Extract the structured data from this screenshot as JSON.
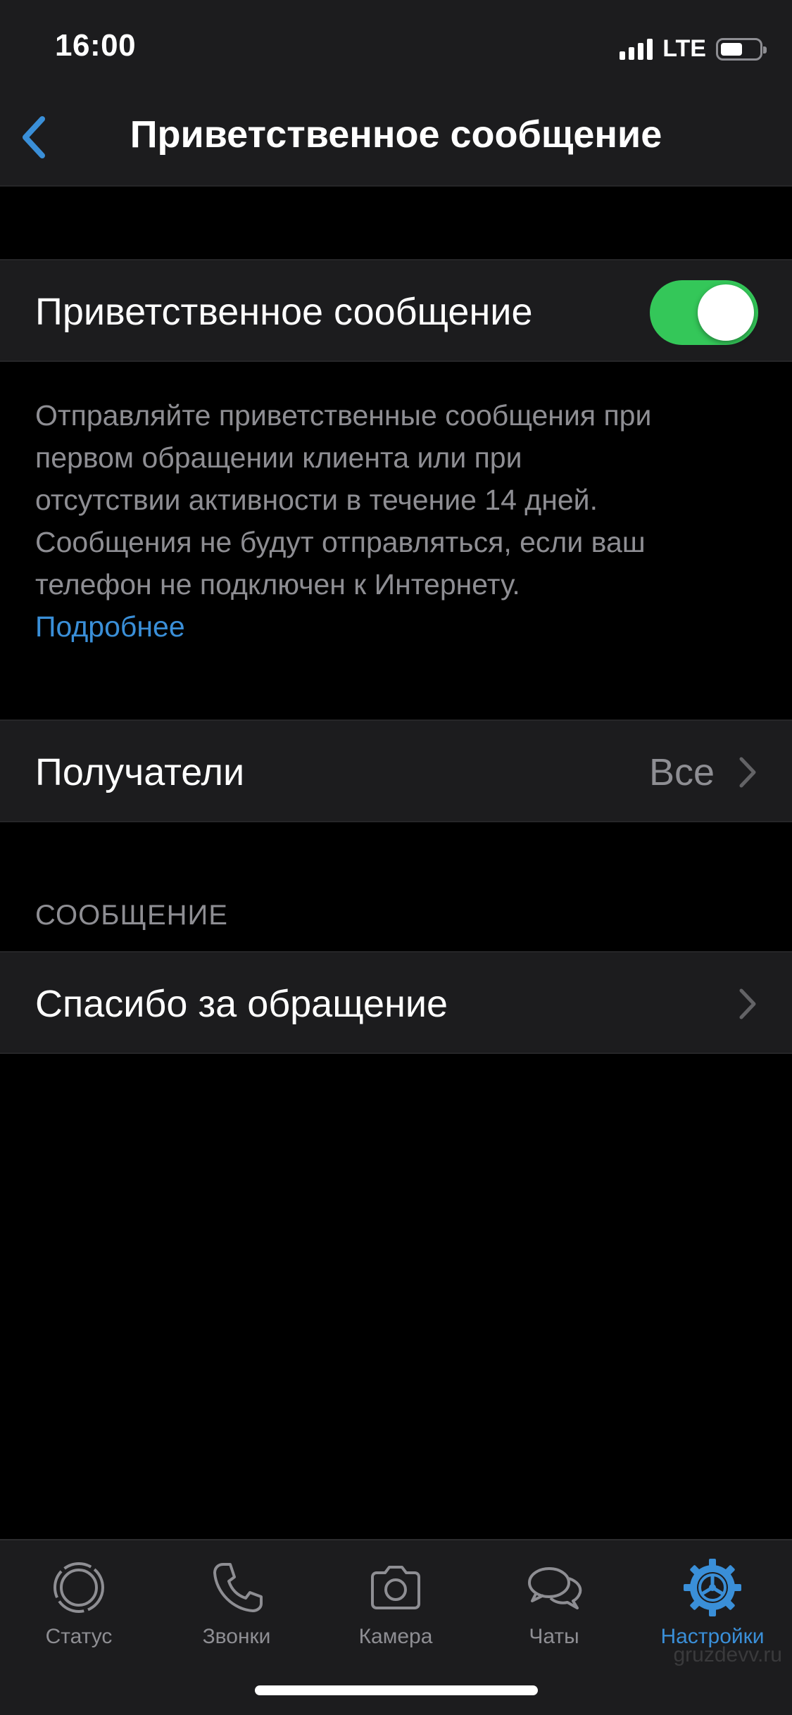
{
  "status_bar": {
    "time": "16:00",
    "network": "LTE",
    "signal_bars": 4,
    "battery_level": 0.55
  },
  "nav": {
    "back_icon": "chevron-left-icon",
    "title": "Приветственное сообщение"
  },
  "welcome_toggle": {
    "label": "Приветственное сообщение",
    "enabled": true,
    "on_color": "#34c759"
  },
  "description": {
    "lines": [
      "Отправляйте приветственные сообщения при",
      "первом обращении клиента или при",
      "отсутствии активности в течение 14 дней.",
      "Сообщения не будут отправляться, если ваш",
      "телефон не подключен к Интернету."
    ],
    "link": "Подробнее"
  },
  "recipients": {
    "label": "Получатели",
    "value": "Все"
  },
  "message_section": {
    "header": "СООБЩЕНИЕ",
    "message": "Спасибо за обращение"
  },
  "tabbar": {
    "active_color": "#3a8fd8",
    "items": [
      {
        "label": "Статус",
        "icon": "status-icon",
        "active": false
      },
      {
        "label": "Звонки",
        "icon": "phone-icon",
        "active": false
      },
      {
        "label": "Камера",
        "icon": "camera-icon",
        "active": false
      },
      {
        "label": "Чаты",
        "icon": "chats-icon",
        "active": false
      },
      {
        "label": "Настройки",
        "icon": "settings-gear-icon",
        "active": true
      }
    ]
  },
  "watermark": "gruzdevv.ru"
}
